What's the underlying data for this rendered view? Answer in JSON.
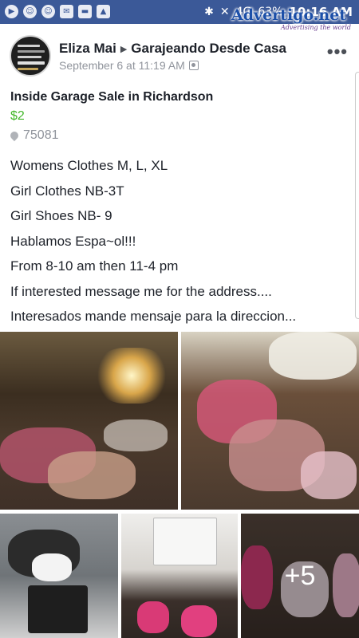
{
  "status_bar": {
    "time": "10:16 AM",
    "battery": "63%",
    "network": "4G"
  },
  "watermark": {
    "title": "Advertigo.net",
    "slogan": "Advertising the world"
  },
  "post": {
    "author": "Eliza Mai",
    "group": "Garajeando Desde Casa",
    "timestamp": "September 6 at 11:19 AM",
    "title": "Inside Garage Sale in Richardson",
    "price": "$2",
    "zip": "75081",
    "lines": [
      "Womens Clothes M, L, XL",
      "Girl Clothes NB-3T",
      "Girl Shoes NB- 9",
      "Hablamos Espa~ol!!!",
      "From 8-10 am then 11-4 pm",
      "If interested message me for the address....",
      "Interesados mande mensaje para la direccion..."
    ],
    "more_photos": "+5",
    "avatar_text": [
      "FAMILIA DIARIO",
      "LA SALUD ES",
      "TU EXITO",
      "EL RUIDO"
    ]
  },
  "colors": {
    "brand": "#3b5998",
    "price": "#42b72a",
    "muted": "#90949c"
  }
}
